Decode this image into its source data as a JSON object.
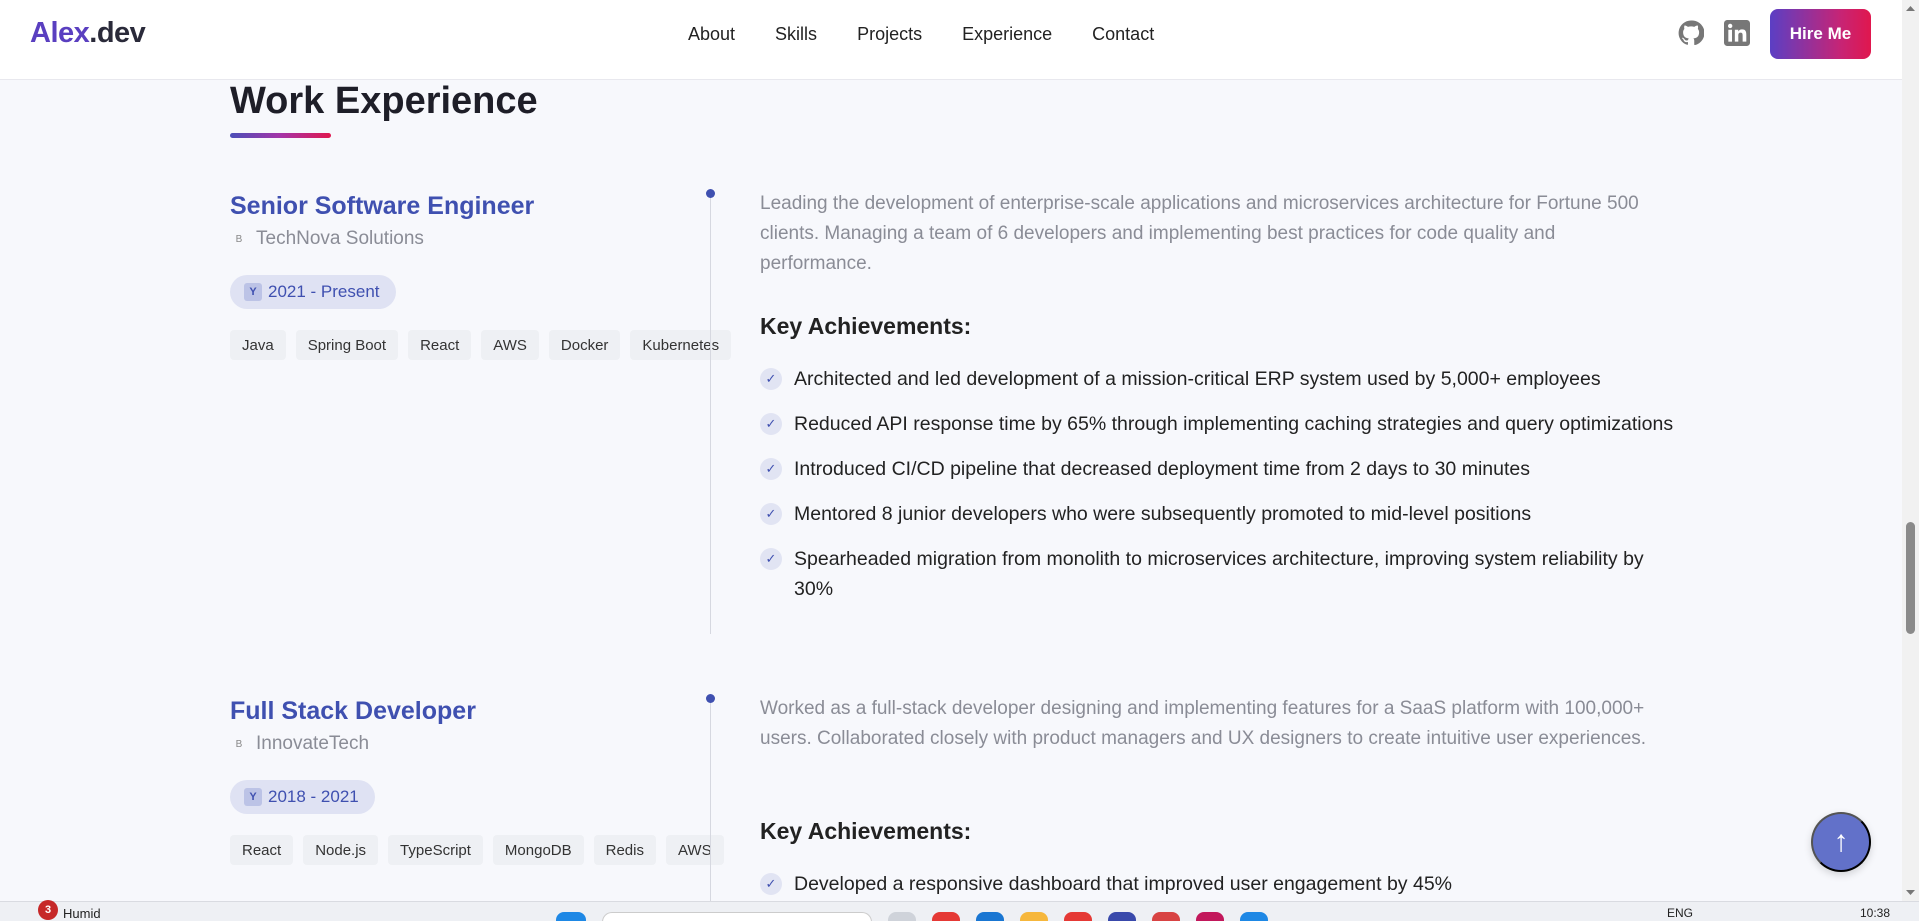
{
  "nav": {
    "logo_brand": "Alex",
    "logo_tld": ".dev",
    "links": [
      "About",
      "Skills",
      "Projects",
      "Experience",
      "Contact"
    ],
    "icons": [
      "github-icon",
      "linkedin-icon"
    ],
    "hire_label": "Hire Me"
  },
  "section": {
    "title": "Work Experience"
  },
  "experiences": [
    {
      "role": "Senior Software Engineer",
      "company_icon": "B",
      "company": "TechNova Solutions",
      "period_icon": "Y",
      "period": "2021 - Present",
      "tags": [
        "Java",
        "Spring Boot",
        "React",
        "AWS",
        "Docker",
        "Kubernetes"
      ],
      "description": "Leading the development of enterprise-scale applications and microservices architecture for Fortune 500 clients. Managing a team of 6 developers and implementing best practices for code quality and performance.",
      "achievements_title": "Key Achievements:",
      "achievements": [
        "Architected and led development of a mission-critical ERP system used by 5,000+ employees",
        "Reduced API response time by 65% through implementing caching strategies and query optimizations",
        "Introduced CI/CD pipeline that decreased deployment time from 2 days to 30 minutes",
        "Mentored 8 junior developers who were subsequently promoted to mid-level positions",
        "Spearheaded migration from monolith to microservices architecture, improving system reliability by 30%"
      ]
    },
    {
      "role": "Full Stack Developer",
      "company_icon": "B",
      "company": "InnovateTech",
      "period_icon": "Y",
      "period": "2018 - 2021",
      "tags": [
        "React",
        "Node.js",
        "TypeScript",
        "MongoDB",
        "Redis",
        "AWS"
      ],
      "description": "Worked as a full-stack developer designing and implementing features for a SaaS platform with 100,000+ users. Collaborated closely with product managers and UX designers to create intuitive user experiences.",
      "achievements_title": "Key Achievements:",
      "achievements": [
        "Developed a responsive dashboard that improved user engagement by 45%"
      ]
    }
  ],
  "fab": {
    "label": "↑"
  },
  "check_glyph": "✓",
  "taskbar": {
    "badge": "3",
    "weather": "Humid",
    "lang": "ENG",
    "time": "10:38"
  },
  "colors": {
    "accent": "#3f50b0",
    "brand": "#5a3fc0",
    "hire_gradient_end": "#e0174e"
  }
}
